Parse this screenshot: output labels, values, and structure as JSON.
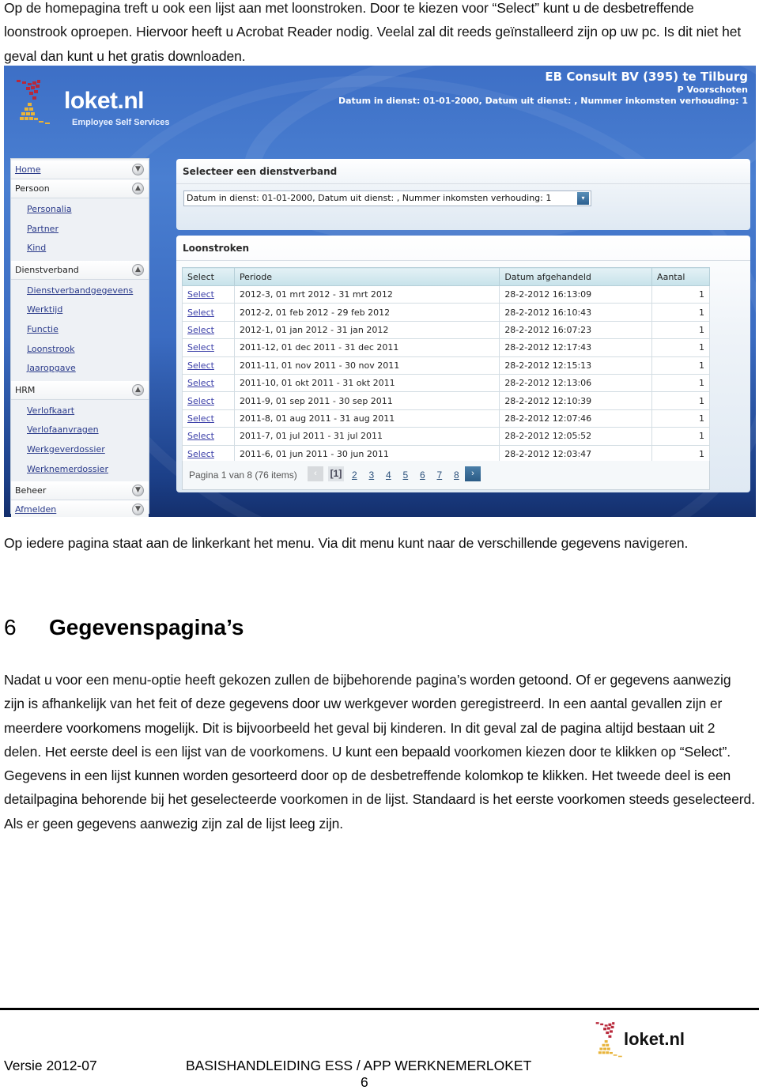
{
  "intro_text": "Op de homepagina treft u ook een lijst aan met loonstroken. Door te kiezen voor “Select” kunt u de desbetreffende loonstrook oproepen. Hiervoor heeft u Acrobat Reader nodig. Veelal zal dit reeds geïnstalleerd zijn op uw pc. Is dit niet het geval dan kunt u het gratis downloaden.",
  "screenshot": {
    "logo": {
      "text": "loket.nl",
      "subtitle": "Employee Self Services",
      "icon": "loket-logo-icon"
    },
    "header": {
      "company": "EB Consult BV (395) te Tilburg",
      "person": "P Voorschoten",
      "employment_info": "Datum in dienst: 01-01-2000, Datum uit dienst: , Nummer inkomsten verhouding: 1"
    },
    "sidebar": {
      "sections": [
        {
          "label": "Home",
          "link": true,
          "icon": "expand-down-icon",
          "items": []
        },
        {
          "label": "Persoon",
          "link": false,
          "icon": "collapse-up-icon",
          "items": [
            "Personalia",
            "Partner",
            "Kind"
          ]
        },
        {
          "label": "Dienstverband",
          "link": false,
          "icon": "collapse-up-icon",
          "items": [
            "Dienstverbandgegevens",
            "Werktijd",
            "Functie",
            "Loonstrook",
            "Jaaropgave"
          ]
        },
        {
          "label": "HRM",
          "link": false,
          "icon": "collapse-up-icon",
          "items": [
            "Verlofkaart",
            "Verlofaanvragen",
            "Werkgeverdossier",
            "Werknemerdossier"
          ]
        },
        {
          "label": "Beheer",
          "link": false,
          "icon": "expand-down-icon",
          "items": []
        },
        {
          "label": "Afmelden",
          "link": true,
          "icon": "expand-down-icon",
          "items": []
        }
      ]
    },
    "select_panel": {
      "title": "Selecteer een dienstverband",
      "dropdown_value": "Datum in dienst: 01-01-2000, Datum uit dienst: , Nummer inkomsten verhouding: 1",
      "dropdown_icon": "▾"
    },
    "loon_panel": {
      "title": "Loonstroken",
      "columns": [
        "Select",
        "Periode",
        "Datum afgehandeld",
        "Aantal"
      ],
      "rows": [
        {
          "select": "Select",
          "periode": "2012-3, 01 mrt 2012 - 31 mrt 2012",
          "datum": "28-2-2012 16:13:09",
          "aantal": "1"
        },
        {
          "select": "Select",
          "periode": "2012-2, 01 feb 2012 - 29 feb 2012",
          "datum": "28-2-2012 16:10:43",
          "aantal": "1"
        },
        {
          "select": "Select",
          "periode": "2012-1, 01 jan 2012 - 31 jan 2012",
          "datum": "28-2-2012 16:07:23",
          "aantal": "1"
        },
        {
          "select": "Select",
          "periode": "2011-12, 01 dec 2011 - 31 dec 2011",
          "datum": "28-2-2012 12:17:43",
          "aantal": "1"
        },
        {
          "select": "Select",
          "periode": "2011-11, 01 nov 2011 - 30 nov 2011",
          "datum": "28-2-2012 12:15:13",
          "aantal": "1"
        },
        {
          "select": "Select",
          "periode": "2011-10, 01 okt 2011 - 31 okt 2011",
          "datum": "28-2-2012 12:13:06",
          "aantal": "1"
        },
        {
          "select": "Select",
          "periode": "2011-9, 01 sep 2011 - 30 sep 2011",
          "datum": "28-2-2012 12:10:39",
          "aantal": "1"
        },
        {
          "select": "Select",
          "periode": "2011-8, 01 aug 2011 - 31 aug 2011",
          "datum": "28-2-2012 12:07:46",
          "aantal": "1"
        },
        {
          "select": "Select",
          "periode": "2011-7, 01 jul 2011 - 31 jul 2011",
          "datum": "28-2-2012 12:05:52",
          "aantal": "1"
        },
        {
          "select": "Select",
          "periode": "2011-6, 01 jun 2011 - 30 jun 2011",
          "datum": "28-2-2012 12:03:47",
          "aantal": "1"
        }
      ],
      "pager": {
        "info": "Pagina 1 van 8 (76 items)",
        "prev_icon": "‹",
        "current": "[1]",
        "pages": [
          "2",
          "3",
          "4",
          "5",
          "6",
          "7",
          "8"
        ],
        "next_icon": "›"
      }
    }
  },
  "menu_text": "Op iedere pagina staat aan de linkerkant het menu. Via dit menu kunt naar de verschillende gegevens navigeren.",
  "section": {
    "number": "6",
    "title": "Gegevenspagina’s"
  },
  "body_text": "Nadat u voor een menu-optie heeft gekozen zullen de bijbehorende pagina’s worden getoond. Of er gegevens aanwezig zijn is afhankelijk van het feit of deze gegevens door uw werkgever worden geregistreerd. In een aantal gevallen zijn er meerdere voorkomens mogelijk. Dit is bijvoorbeeld het geval bij kinderen. In dit geval zal de pagina altijd bestaan uit 2 delen. Het eerste deel is een lijst van de voorkomens. U kunt een bepaald voorkomen kiezen door te klikken op “Select”. Gegevens in een lijst kunnen worden gesorteerd door op de desbetreffende kolomkop te klikken. Het tweede deel is een detailpagina behorende bij het geselecteerde voorkomen in de lijst. Standaard is het eerste voorkomen steeds geselecteerd. Als er geen gegevens aanwezig zijn zal de lijst leeg zijn.",
  "footer": {
    "version": "Versie 2012-07",
    "title": "BASISHANDLEIDING ESS / APP WERKNEMERLOKET",
    "page": "6",
    "logo_text": "loket.nl"
  },
  "colors": {
    "brand_blue": "#3d6fc6",
    "logo_red": "#b8283a",
    "logo_yellow": "#e8b43a",
    "link": "#3b3fa8"
  }
}
